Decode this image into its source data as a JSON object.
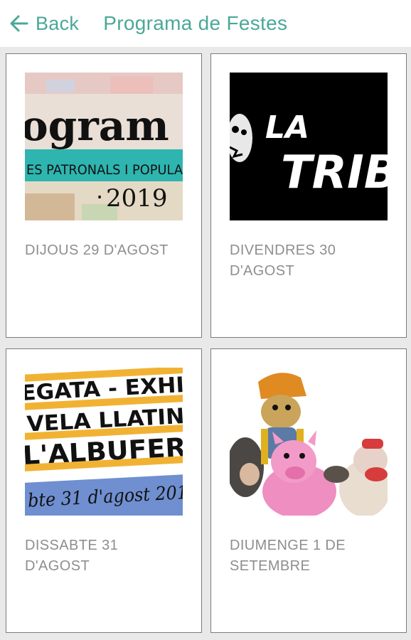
{
  "header": {
    "back_label": "Back",
    "title": "Programa de Festes"
  },
  "colors": {
    "accent": "#4aa898",
    "card_label": "#8e8e8e",
    "background": "#e9e9e9"
  },
  "cards": [
    {
      "label": "DIJOUS 29 D'AGOST",
      "image_text": {
        "big": "ogram",
        "band": "ES PATRONALS I POPULA",
        "year": "2019"
      }
    },
    {
      "label": "DIVENDRES 30 D'AGOST",
      "image_text": {
        "line1": "LA",
        "line2": "TRIB"
      }
    },
    {
      "label": "DISSABTE 31 D'AGOST",
      "image_text": {
        "line1": "EGATA - EXHI",
        "line2": "VELA LLATIN",
        "line3": "L'ALBUFER",
        "line4": "bte 31 d'agost 201"
      }
    },
    {
      "label": "DIUMENGE 1 DE SETEMBRE",
      "image_text": {}
    }
  ]
}
